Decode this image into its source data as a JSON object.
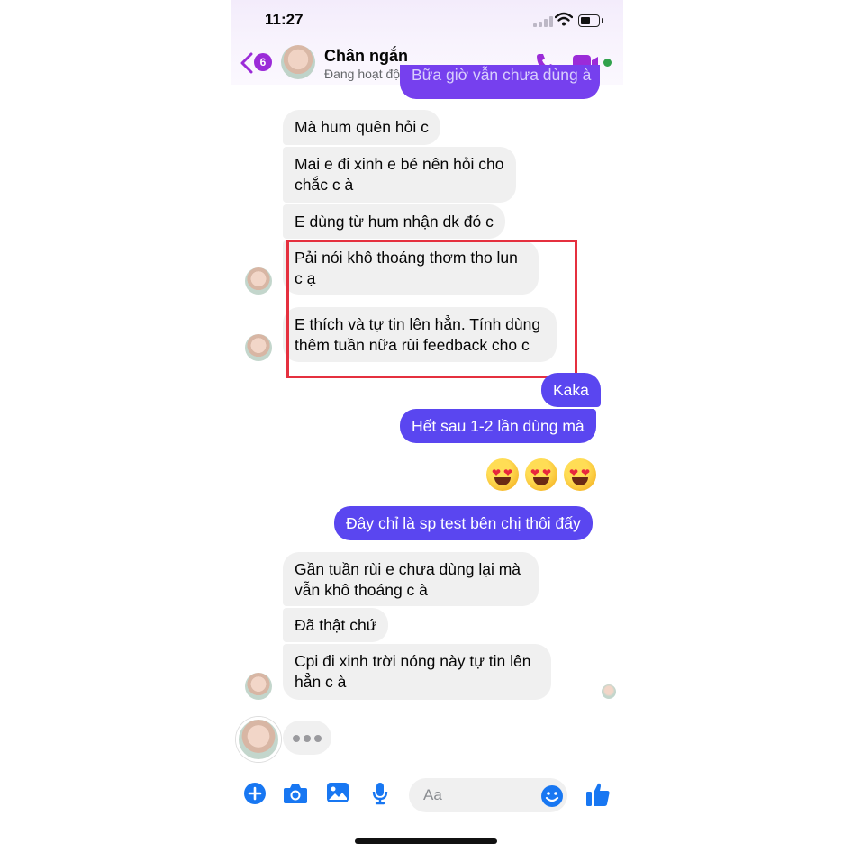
{
  "status_bar": {
    "time": "11:27"
  },
  "header": {
    "back_count": "6",
    "contact_name": "Chân ngắn",
    "contact_status": "Đang hoạt động"
  },
  "messages": {
    "top_partial": "Bữa giờ vẫn chưa dùng à",
    "m1": "Mà hum quên hỏi c",
    "m2_line1": "Mai e đi xinh e bé nên hỏi cho",
    "m2_line2": "chắc c à",
    "m3": "E dùng từ hum nhận dk đó c",
    "m4_line1": "Pải nói khô thoáng thơm tho lun",
    "m4_line2": "c ạ",
    "m5_line1": "E thích và tự tin lên hẳn. Tính dùng",
    "m5_line2": "thêm tuần nữa rùi feedback  cho c",
    "m6": "Kaka",
    "m7": "Hết sau 1-2 lần dùng mà",
    "m8": "Đây chỉ là sp test bên chị thôi đấy",
    "m9_line1": "Gần tuần rùi e chưa dùng lại mà",
    "m9_line2": "vẫn khô thoáng c à",
    "m10": "Đã thật chứ",
    "m11_line1": "Cpi đi xinh trời nóng này tự tin lên",
    "m11_line2": "hẳn c à"
  },
  "emoji_reaction": "heart-eyes x3",
  "composer": {
    "placeholder": "Aa"
  },
  "colors": {
    "accent": "#5a46f0",
    "brand_purple": "#9b2bd8",
    "icon_blue": "#1877f2",
    "highlight_box": "#e5303f",
    "online_dot": "#31a24c"
  }
}
